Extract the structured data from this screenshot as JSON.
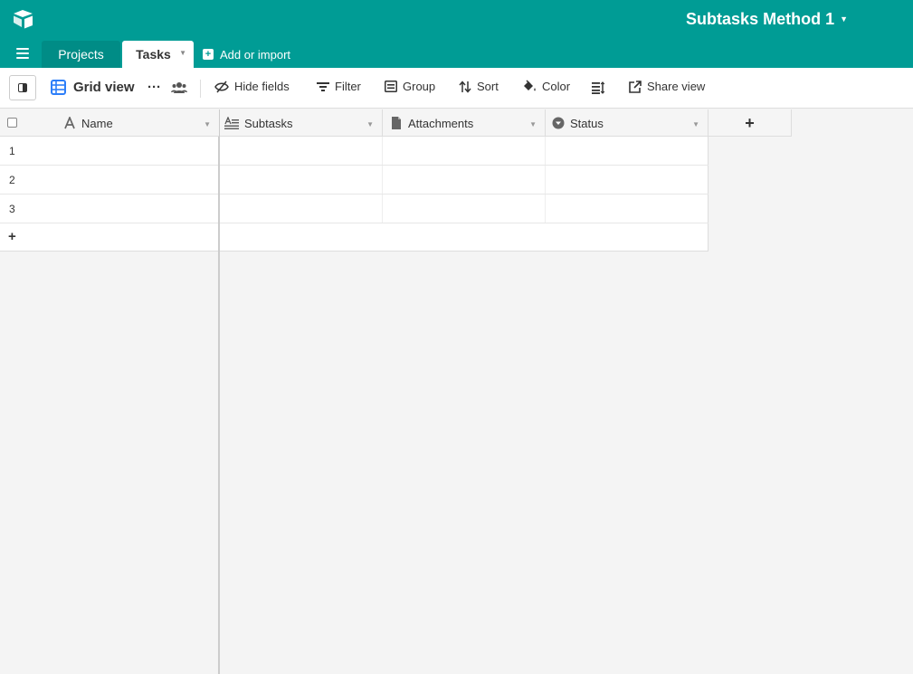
{
  "app": {
    "base_title": "Subtasks Method 1",
    "brand_color": "#009c95",
    "logo_icon": "airtable-logo-icon"
  },
  "tabs": [
    {
      "label": "Projects"
    },
    {
      "label": "Tasks"
    }
  ],
  "add_import_label": "Add or import",
  "toolbar": {
    "view_name": "Grid view",
    "more_label": "···",
    "hide_fields": "Hide fields",
    "filter": "Filter",
    "group": "Group",
    "sort": "Sort",
    "color": "Color",
    "share_view": "Share view"
  },
  "columns": [
    {
      "label": "Name",
      "icon": "text-field-icon"
    },
    {
      "label": "Subtasks",
      "icon": "long-text-field-icon"
    },
    {
      "label": "Attachments",
      "icon": "attachment-field-icon"
    },
    {
      "label": "Status",
      "icon": "single-select-field-icon"
    }
  ],
  "add_column_label": "+",
  "rows": [
    {
      "num": "1",
      "name": "",
      "subtasks": "",
      "attachments": "",
      "status": ""
    },
    {
      "num": "2",
      "name": "",
      "subtasks": "",
      "attachments": "",
      "status": ""
    },
    {
      "num": "3",
      "name": "",
      "subtasks": "",
      "attachments": "",
      "status": ""
    }
  ],
  "add_row_label": "+"
}
